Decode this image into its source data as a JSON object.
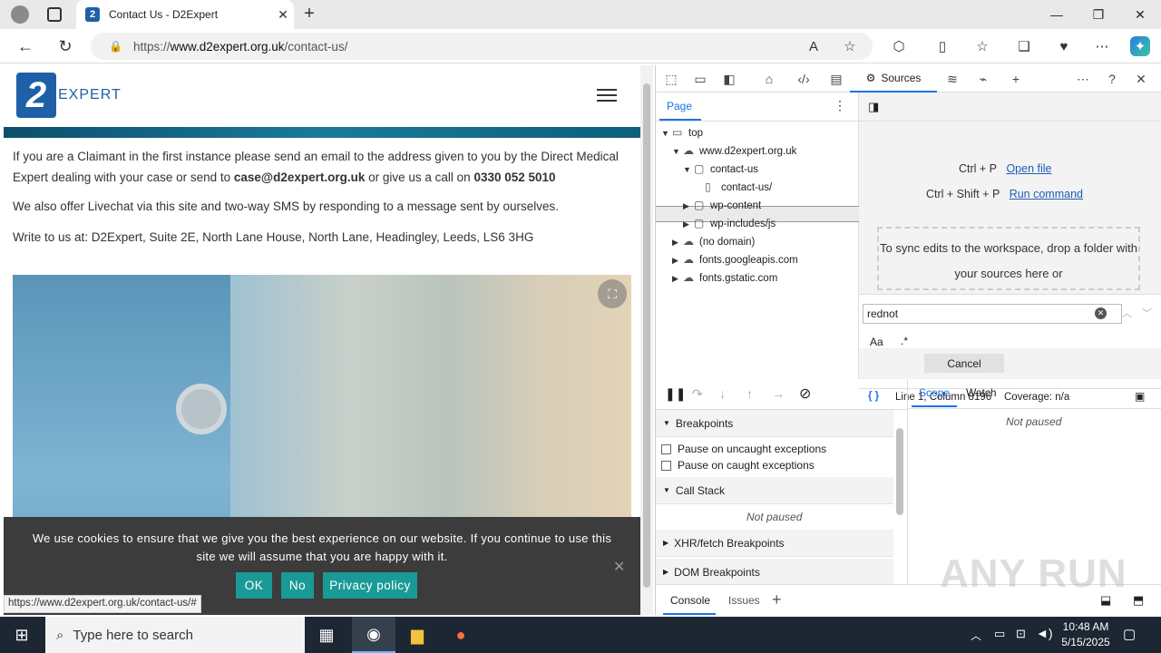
{
  "browser": {
    "tab_title": "Contact Us - D2Expert",
    "favicon_letter": "2",
    "url_prefix": "https://",
    "url_domain": "www.d2expert.org.uk",
    "url_path": "/contact-us/",
    "status_url": "https://www.d2expert.org.uk/contact-us/#"
  },
  "site": {
    "logo_mark": "2",
    "logo_text": "EXPERT",
    "para1_a": "If you are a Claimant in the first instance please send an email to the address given to you by the Direct Medical Expert dealing with your case or send to ",
    "para1_email": "case@d2expert.org.uk",
    "para1_b": " or give us a call on ",
    "para1_phone": "0330 052 5010",
    "para2": "We also offer Livechat via this site and two-way SMS by responding to a message sent by ourselves.",
    "para3": "Write to us at: D2Expert, Suite 2E, North Lane House, North Lane, Headingley, Leeds, LS6 3HG",
    "cookie_msg": "We use cookies to ensure that we give you the best experience on our website. If you continue to use this site we will assume that you are happy with it.",
    "cookie_ok": "OK",
    "cookie_no": "No",
    "cookie_privacy": "Privacy policy"
  },
  "devtools": {
    "active_tab": "Sources",
    "nav_tab": "Page",
    "tree": [
      {
        "label": "top",
        "icon": "frame-icon"
      },
      {
        "label": "www.d2expert.org.uk",
        "icon": "cloud-icon"
      },
      {
        "label": "contact-us",
        "icon": "folder-icon"
      },
      {
        "label": "contact-us/",
        "icon": "file-icon"
      },
      {
        "label": "wp-content",
        "icon": "folder-icon"
      },
      {
        "label": "wp-includes/js",
        "icon": "folder-icon"
      },
      {
        "label": "(no domain)",
        "icon": "cloud-icon"
      },
      {
        "label": "fonts.googleapis.com",
        "icon": "cloud-icon"
      },
      {
        "label": "fonts.gstatic.com",
        "icon": "cloud-icon"
      }
    ],
    "shortcut1_key": "Ctrl + P",
    "shortcut1_link": "Open file",
    "shortcut2_key": "Ctrl + Shift + P",
    "shortcut2_link": "Run command",
    "dropzone_text": "To sync edits to the workspace, drop a folder with your sources here or",
    "search_value": "rednot",
    "match_case": "Aa",
    "regex": ".*",
    "cancel": "Cancel",
    "braces": "{ }",
    "cursor_pos": "Line 1, Column 8196",
    "coverage": "Coverage: n/a",
    "breakpoints": "Breakpoints",
    "pause_uncaught": "Pause on uncaught exceptions",
    "pause_caught": "Pause on caught exceptions",
    "call_stack": "Call Stack",
    "not_paused": "Not paused",
    "xhr_breakpoints": "XHR/fetch Breakpoints",
    "dom_breakpoints": "DOM Breakpoints",
    "scope_tab": "Scope",
    "watch_tab": "Watch",
    "console_tab": "Console",
    "issues_tab": "Issues"
  },
  "taskbar": {
    "search_placeholder": "Type here to search",
    "time": "10:48 AM",
    "date": "5/15/2025"
  },
  "watermark": "ANY RUN"
}
